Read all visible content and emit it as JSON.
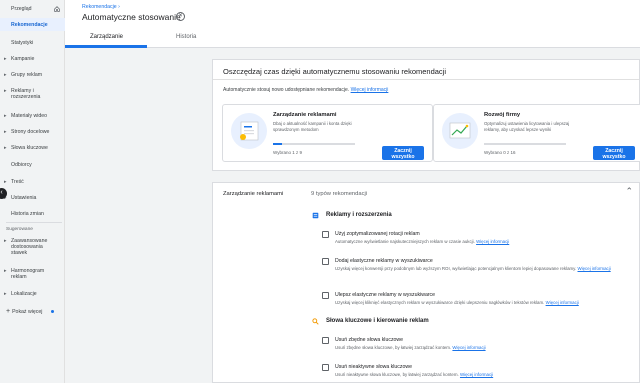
{
  "sidebar": {
    "items": [
      {
        "label": "Przegląd",
        "chevron": false
      },
      {
        "label": "Rekomendacje",
        "chevron": false,
        "active": true
      },
      {
        "label": "Statystyki",
        "chevron": false
      },
      {
        "label": "Kampanie",
        "chevron": true
      },
      {
        "label": "Grupy reklam",
        "chevron": true
      },
      {
        "label": "Reklamy i rozszerzenia",
        "chevron": true
      },
      {
        "label": "Materiały wideo",
        "chevron": true
      },
      {
        "label": "Strony docelowe",
        "chevron": true
      },
      {
        "label": "Słowa kluczowe",
        "chevron": true
      },
      {
        "label": "Odbiorcy",
        "chevron": false
      },
      {
        "label": "Treść",
        "chevron": true
      },
      {
        "label": "Ustawienia",
        "chevron": true
      },
      {
        "label": "Historia zmian",
        "chevron": false
      }
    ],
    "suggested_label": "Sugerowane",
    "suggested": [
      {
        "label": "Zaawansowane dostosowania stawek"
      },
      {
        "label": "Harmonogram reklam"
      },
      {
        "label": "Lokalizacje"
      }
    ],
    "add_more": "Pokaż więcej"
  },
  "header": {
    "breadcrumb": "Rekomendacje",
    "title": "Automatyczne stosowanie",
    "tabs": [
      {
        "label": "Zarządzanie"
      },
      {
        "label": "Historia"
      }
    ]
  },
  "main": {
    "intro_card": {
      "title": "Oszczędzaj czas dzięki automatycznemu stosowaniu rekomendacji",
      "desc": "Automatycznie stosuj nowo udostępniane rekomendacje.",
      "link": "Więcej informacji",
      "subcards": [
        {
          "title": "Zarządzanie reklamami",
          "desc": "Dbaj o aktualność kampanii i konta dzięki sprawdzonym metodom",
          "count": "Wybrano 1 z 9",
          "progress": 0.11,
          "button": "Zacznij wszystko"
        },
        {
          "title": "Rozwój firmy",
          "desc": "Optymalizuj ustawienia licytowania i ulepszaj reklamy, aby uzyskać lepsze wyniki",
          "count": "Wybrano 0 z 16",
          "progress": 0,
          "button": "Zacznij wszystko"
        }
      ]
    },
    "manage_card": {
      "title": "Zarządzanie reklamami",
      "count": "9 typów rekomendacji",
      "groups": [
        {
          "title": "Reklamy i rozszerzenia",
          "recs": [
            {
              "title": "Użyj zoptymalizowanej rotacji reklam",
              "desc": "Automatyczne wyświetlanie najskuteczniejszych reklam w czasie aukcji.",
              "link": "Więcej informacji"
            },
            {
              "title": "Dodaj elastyczne reklamy w wyszukiwarce",
              "desc": "Uzyskaj więcej konwersji przy podobnym lub wyższym ROI, wyświetlając potencjalnym klientom lepiej dopasowane reklamy.",
              "link": "Więcej informacji"
            },
            {
              "title": "Ulepsz elastyczne reklamy w wyszukiwarce",
              "desc": "Uzyskaj więcej kliknięć elastycznych reklam w wyszukiwarce dzięki ulepszeniu nagłówków i tekstów reklam.",
              "link": "Więcej informacji"
            }
          ]
        },
        {
          "title": "Słowa kluczowe i kierowanie reklam",
          "recs": [
            {
              "title": "Usuń zbędne słowa kluczowe",
              "desc": "Usuń zbędne słowa kluczowe, by łatwiej zarządzać kontem.",
              "link": "Więcej informacji"
            },
            {
              "title": "Usuń nieaktywne słowa kluczowe",
              "desc": "Usuń nieaktywne słowa kluczowe, by łatwiej zarządzać kontem.",
              "link": "Więcej informacji"
            }
          ]
        }
      ]
    }
  },
  "colors": {
    "accent": "#1a73e8",
    "active_bg": "#e8f0fe"
  },
  "icons": {
    "home": "home-icon",
    "close": "close-circle-icon",
    "collapse": "collapse-arrow-icon",
    "expand": "chevron-up-icon",
    "ads_group": "ads-icon",
    "keywords_group": "search-icon"
  }
}
